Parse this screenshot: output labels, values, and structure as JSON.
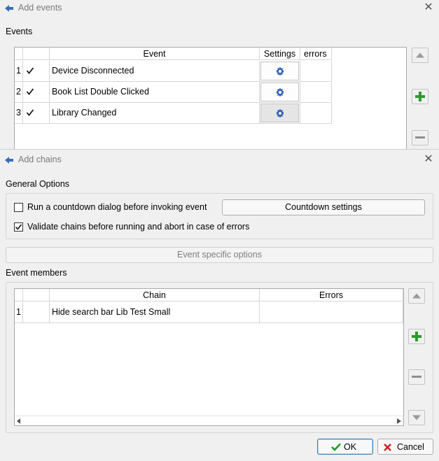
{
  "events_dialog": {
    "title": "Add events",
    "section_label": "Events",
    "columns": [
      "Event",
      "Settings",
      "errors"
    ],
    "rows": [
      {
        "num": "1",
        "checked": true,
        "event": "Device Disconnected",
        "errors": ""
      },
      {
        "num": "2",
        "checked": true,
        "event": "Book List Double Clicked",
        "errors": ""
      },
      {
        "num": "3",
        "checked": true,
        "event": "Library Changed",
        "errors": ""
      }
    ]
  },
  "chains_dialog": {
    "title": "Add chains",
    "general_options_label": "General Options",
    "countdown_label": "Run a countdown dialog before invoking event",
    "countdown_checked": false,
    "countdown_settings_label": "Countdown settings",
    "validate_label": "Validate chains before running and abort in case of errors",
    "validate_checked": true,
    "event_specific_label": "Event specific options",
    "event_members_label": "Event members",
    "columns": [
      "Chain",
      "Errors"
    ],
    "rows": [
      {
        "num": "1",
        "chain": "Hide search bar Lib Test Small",
        "errors": ""
      }
    ],
    "ok_label": "OK",
    "cancel_label": "Cancel"
  },
  "colors": {
    "gear": "#2d5fb8",
    "plus": "#2e9a2e",
    "ok_check": "#1e9b1e",
    "cancel_x": "#cc1f1f"
  },
  "icons": {
    "title_icon": "back-arrow-icon",
    "close": "close-icon",
    "up": "arrow-up-icon",
    "down": "arrow-down-icon",
    "add": "plus-icon",
    "remove": "minus-icon",
    "settings": "gear-icon"
  }
}
